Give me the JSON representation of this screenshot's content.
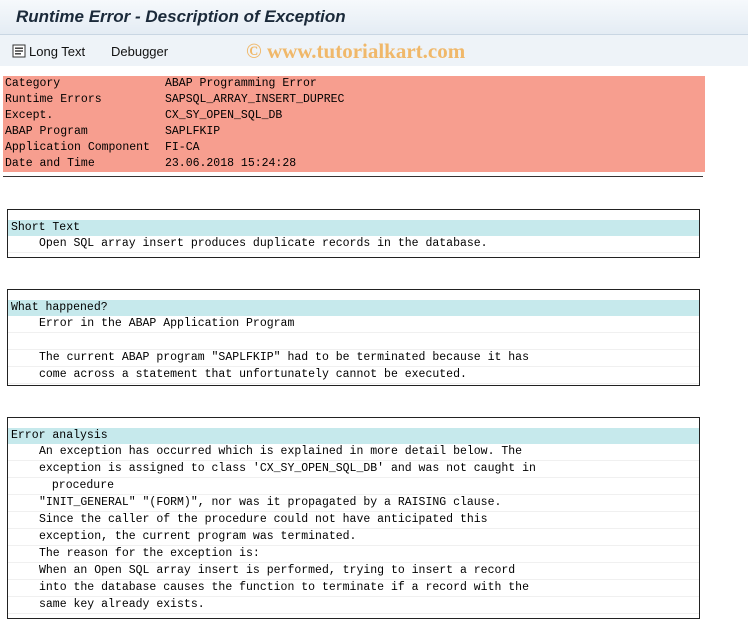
{
  "window": {
    "title": "Runtime Error - Description of Exception"
  },
  "toolbar": {
    "long_text_label": "Long Text",
    "debugger_label": "Debugger",
    "watermark": "© www.tutorialkart.com"
  },
  "header": {
    "rows": [
      {
        "label": "Category",
        "value": "ABAP Programming Error"
      },
      {
        "label": "Runtime Errors",
        "value": "SAPSQL_ARRAY_INSERT_DUPREC"
      },
      {
        "label": "Except.",
        "value": "CX_SY_OPEN_SQL_DB"
      },
      {
        "label": "ABAP Program",
        "value": "SAPLFKIP"
      },
      {
        "label": "Application Component",
        "value": "FI-CA"
      },
      {
        "label": "Date and Time",
        "value": "23.06.2018 15:24:28"
      }
    ]
  },
  "short_text": {
    "heading": "Short Text",
    "lines": [
      "Open SQL array insert produces duplicate records in the database."
    ]
  },
  "what_happened": {
    "heading": "What happened?",
    "lines": [
      "Error in the ABAP Application Program",
      "",
      "The current ABAP program \"SAPLFKIP\" had to be terminated because it has",
      "come across a statement that unfortunately cannot be executed."
    ]
  },
  "error_analysis": {
    "heading": "Error analysis",
    "lines": [
      "An exception has occurred which is explained in more detail below. The",
      "exception is assigned to class 'CX_SY_OPEN_SQL_DB' and was not caught in",
      " procedure",
      "\"INIT_GENERAL\" \"(FORM)\", nor was it propagated by a RAISING clause.",
      "Since the caller of the procedure could not have anticipated this",
      "exception, the current program was terminated.",
      "The reason for the exception is:",
      "When an Open SQL array insert is performed, trying to insert a record",
      "into the database causes the function to terminate if a record with the",
      "same key already exists."
    ]
  }
}
